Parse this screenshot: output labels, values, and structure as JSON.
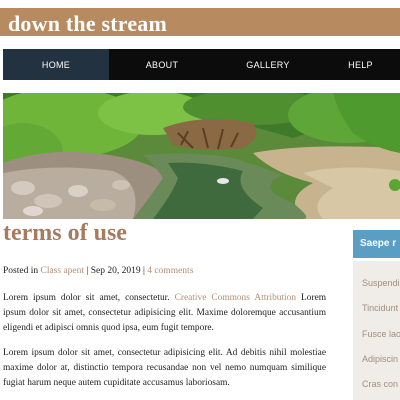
{
  "site": {
    "title": "down the stream"
  },
  "nav": {
    "items": [
      "HOME",
      "ABOUT",
      "GALLERY",
      "HELP"
    ],
    "active": "HOME"
  },
  "hero": {
    "description": "photo of a stream with green mossy banks, exposed tree roots and rocks"
  },
  "article": {
    "title": "terms of use",
    "meta": {
      "posted_in_label": "Posted in",
      "category": "Class apent",
      "separator": "|",
      "date": "Sep 20, 2019",
      "comments": "4 comments"
    },
    "p1": {
      "before": "Lorem ipsum dolor sit amet, consectetur.",
      "link": "Creative Commons Attribution",
      "after": "Lorem ipsum dolor sit amet, consectetur adipisicing elit. Maxime doloremque accusantium eligendi et adipisci omnis quod ipsa, eum fugit tempore."
    },
    "p2": "Lorem ipsum dolor sit amet, consectetur adipisicing elit. Ad debitis nihil molestiae maxime dolor at, distinctio tempora recusandae non vel nemo numquam similique fugiat harum neque autem cupiditate accusamus laboriosam."
  },
  "sidebar": {
    "heading": "Saepe r",
    "links": [
      "Suspendis",
      "Tincidunt",
      "Fusce lao",
      "Adipiscin",
      "Cras con"
    ]
  },
  "colors": {
    "header_bg": "#b78a5f",
    "nav_bg": "#0c0c0c",
    "nav_active": "#223240",
    "title": "#a67b5f",
    "link": "#b08f78",
    "sidebar_head": "#5b9ec3",
    "sidebar_body": "#f0ece8"
  }
}
